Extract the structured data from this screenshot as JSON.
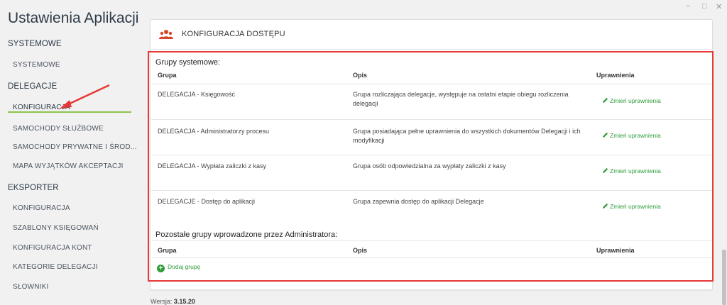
{
  "app": {
    "title": "Ustawienia Aplikacji"
  },
  "sidebar": {
    "sections": [
      {
        "label": "SYSTEMOWE",
        "items": [
          "SYSTEMOWE"
        ]
      },
      {
        "label": "DELEGACJE",
        "items": [
          "KONFIGURACJA",
          "SAMOCHODY SŁUŻBOWE",
          "SAMOCHODY PRYWATNE I ŚROD...",
          "MAPA WYJĄTKÓW AKCEPTACJI"
        ]
      },
      {
        "label": "EKSPORTER",
        "items": [
          "KONFIGURACJA",
          "SZABLONY KSIĘGOWAŃ",
          "KONFIGURACJA KONT",
          "KATEGORIE DELEGACJI",
          "SŁOWNIKI"
        ]
      }
    ],
    "active_item": "KONFIGURACJA"
  },
  "window": {
    "minimize": "−",
    "maximize": "□",
    "close": "✕"
  },
  "panel": {
    "title": "KONFIGURACJA DOSTĘPU",
    "icon": "users-group-icon"
  },
  "system_groups": {
    "title": "Grupy systemowe:",
    "columns": {
      "group": "Grupa",
      "description": "Opis",
      "permissions": "Uprawnienia"
    },
    "rows": [
      {
        "group": "DELEGACJA - Księgowość",
        "description": "Grupa rozliczająca delegacje, występuje na ostatni etapie obiegu rozliczenia delegacji",
        "action": "Zmień uprawnienia"
      },
      {
        "group": "DELEGACJA - Administratorzy procesu",
        "description": "Grupa posiadająca pełne uprawnienia do wszystkich dokumentów Delegacji i ich modyfikacji",
        "action": "Zmień uprawnienia"
      },
      {
        "group": "DELEGACJA - Wypłata zaliczki z kasy",
        "description": "Grupa osób odpowiedzialna za wypłaty zaliczki z kasy",
        "action": "Zmień uprawnienia"
      },
      {
        "group": "DELEGACJE - Dostęp do aplikacji",
        "description": "Grupa zapewnia dostęp do aplikacji Delegacje",
        "action": "Zmień uprawnienia"
      }
    ]
  },
  "admin_groups": {
    "title": "Pozostałe grupy wprowadzone przez Administratora:",
    "columns": {
      "group": "Grupa",
      "description": "Opis",
      "permissions": "Uprawnienia"
    },
    "add_label": "Dodaj grupę"
  },
  "footer": {
    "version_label": "Wersja:",
    "version": "3.15.20"
  },
  "colors": {
    "accent_green": "#2e9d3b",
    "active_underline": "#8bc34a",
    "highlight_red": "#e53935",
    "icon_red": "#d9452b"
  }
}
